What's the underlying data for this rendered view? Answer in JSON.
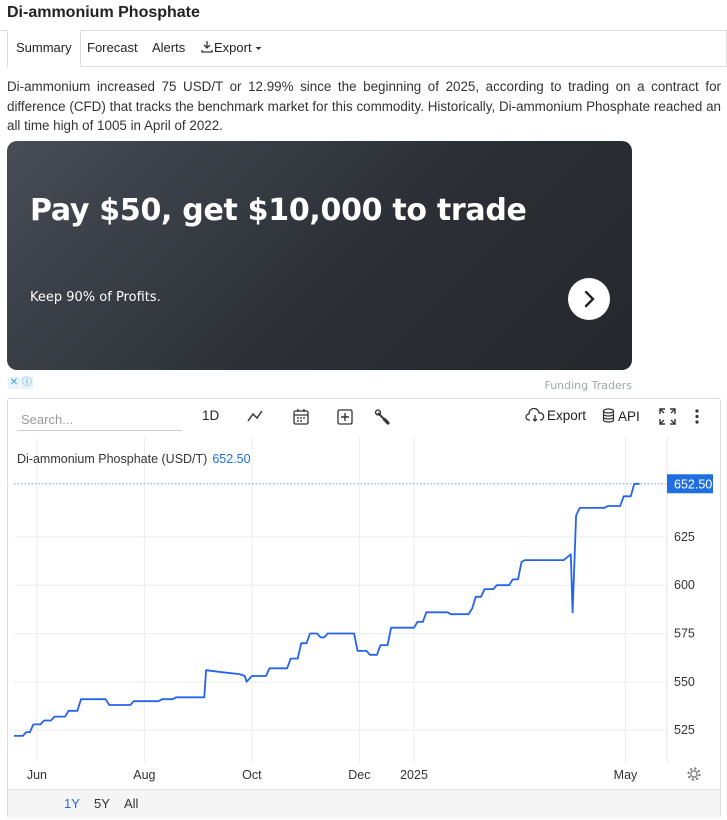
{
  "page": {
    "title": "Di-ammonium Phosphate"
  },
  "tabs": [
    {
      "label": "Summary"
    },
    {
      "label": "Forecast"
    },
    {
      "label": "Alerts"
    },
    {
      "label": "Export"
    }
  ],
  "description": "Di-ammonium increased 75 USD/T or 12.99% since the beginning of 2025, according to trading on a contract for difference (CFD) that tracks the benchmark market for this commodity. Historically, Di-ammonium Phosphate reached an all time high of 1005 in April of 2022.",
  "ad": {
    "headline": "Pay $50, get $10,000 to trade",
    "subtext": "Keep 90% of Profits.",
    "sponsor": "Funding Traders"
  },
  "toolbar": {
    "search_placeholder": "Search...",
    "interval": "1D",
    "export_label": "Export",
    "api_label": "API"
  },
  "range_buttons": [
    "1Y",
    "5Y",
    "All"
  ],
  "colors": {
    "series": "#2563eb",
    "accent": "#1f6fe0",
    "grid": "#ececec"
  },
  "chart_data": {
    "type": "line",
    "series_label": "Di-ammonium Phosphate (USD/T)",
    "last_value": "652.50",
    "ylim": [
      508,
      656
    ],
    "yticks": [
      525,
      550,
      575,
      600,
      625
    ],
    "x_tick_labels": [
      "Jun",
      "Aug",
      "Oct",
      "Dec",
      "2025",
      "May"
    ],
    "x_tick_dates": [
      "2024-06-01",
      "2024-08-01",
      "2024-10-01",
      "2024-12-01",
      "2025-01-01",
      "2025-05-01"
    ],
    "xlim": [
      "2024-05-19",
      "2025-05-24"
    ],
    "grid": true,
    "series": [
      {
        "name": "Di-ammonium Phosphate (USD/T)",
        "points": [
          [
            "2024-05-19",
            522
          ],
          [
            "2024-05-24",
            522
          ],
          [
            "2024-05-26",
            524
          ],
          [
            "2024-05-28",
            524
          ],
          [
            "2024-05-30",
            528
          ],
          [
            "2024-06-03",
            528
          ],
          [
            "2024-06-05",
            530
          ],
          [
            "2024-06-09",
            530
          ],
          [
            "2024-06-11",
            532
          ],
          [
            "2024-06-17",
            532
          ],
          [
            "2024-06-19",
            535
          ],
          [
            "2024-06-24",
            535
          ],
          [
            "2024-06-26",
            541
          ],
          [
            "2024-07-10",
            541
          ],
          [
            "2024-07-12",
            538
          ],
          [
            "2024-07-24",
            538
          ],
          [
            "2024-07-26",
            540
          ],
          [
            "2024-08-09",
            540
          ],
          [
            "2024-08-11",
            541
          ],
          [
            "2024-08-17",
            541
          ],
          [
            "2024-08-19",
            542
          ],
          [
            "2024-09-04",
            542
          ],
          [
            "2024-09-05",
            556
          ],
          [
            "2024-09-14",
            555
          ],
          [
            "2024-09-24",
            554
          ],
          [
            "2024-09-27",
            553
          ],
          [
            "2024-09-28",
            550
          ],
          [
            "2024-10-01",
            553
          ],
          [
            "2024-10-09",
            553
          ],
          [
            "2024-10-11",
            557
          ],
          [
            "2024-10-21",
            557
          ],
          [
            "2024-10-23",
            562
          ],
          [
            "2024-10-27",
            562
          ],
          [
            "2024-10-29",
            570
          ],
          [
            "2024-11-01",
            570
          ],
          [
            "2024-11-03",
            575
          ],
          [
            "2024-11-07",
            575
          ],
          [
            "2024-11-09",
            573
          ],
          [
            "2024-11-11",
            573
          ],
          [
            "2024-11-13",
            575
          ],
          [
            "2024-11-28",
            575
          ],
          [
            "2024-11-30",
            566
          ],
          [
            "2024-12-05",
            566
          ],
          [
            "2024-12-07",
            564
          ],
          [
            "2024-12-11",
            564
          ],
          [
            "2024-12-13",
            569
          ],
          [
            "2024-12-17",
            569
          ],
          [
            "2024-12-19",
            578
          ],
          [
            "2025-01-01",
            578
          ],
          [
            "2025-01-03",
            581
          ],
          [
            "2025-01-06",
            581
          ],
          [
            "2025-01-08",
            586
          ],
          [
            "2025-01-20",
            586
          ],
          [
            "2025-01-22",
            585
          ],
          [
            "2025-02-01",
            585
          ],
          [
            "2025-02-03",
            588
          ],
          [
            "2025-02-05",
            594
          ],
          [
            "2025-02-08",
            594
          ],
          [
            "2025-02-10",
            598
          ],
          [
            "2025-02-15",
            598
          ],
          [
            "2025-02-17",
            600
          ],
          [
            "2025-02-24",
            600
          ],
          [
            "2025-02-26",
            603
          ],
          [
            "2025-03-01",
            603
          ],
          [
            "2025-03-03",
            612
          ],
          [
            "2025-03-05",
            613
          ],
          [
            "2025-03-15",
            613
          ],
          [
            "2025-03-23",
            613
          ],
          [
            "2025-03-27",
            613
          ],
          [
            "2025-03-31",
            616
          ],
          [
            "2025-04-01",
            586
          ],
          [
            "2025-04-03",
            636
          ],
          [
            "2025-04-05",
            640
          ],
          [
            "2025-04-19",
            640
          ],
          [
            "2025-04-21",
            641
          ],
          [
            "2025-04-28",
            641
          ],
          [
            "2025-04-30",
            646
          ],
          [
            "2025-05-04",
            646
          ],
          [
            "2025-05-06",
            652.5
          ],
          [
            "2025-05-09",
            652.5
          ]
        ]
      }
    ]
  }
}
